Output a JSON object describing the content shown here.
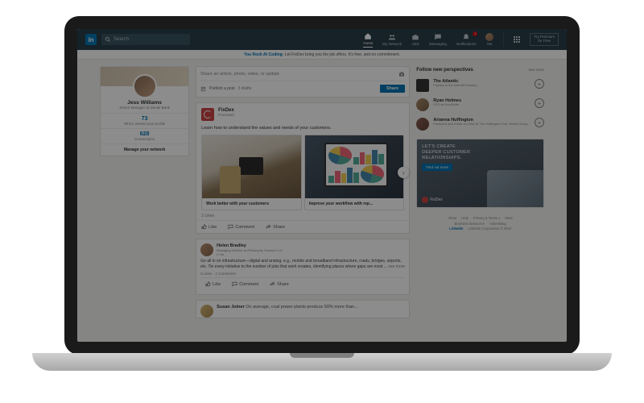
{
  "topbar": {
    "logo_text": "in",
    "search_placeholder": "Search",
    "nav": {
      "home": "Home",
      "network": "My Network",
      "jobs": "Jobs",
      "messaging": "Messaging",
      "notifications": "Notifications",
      "me": "Me",
      "notif_badge": "1"
    },
    "premium_line1": "Try Premium",
    "premium_line2": "for Free"
  },
  "banner": {
    "bold": "You Rock At Coding",
    "rest": " - Let FixDex bring you the job offers. It's free, and no commitment."
  },
  "profile": {
    "name": "Jess Williams",
    "title": "Senior Manager at Denali Bank",
    "views_count": "73",
    "views_label": "Who's viewed your profile",
    "conn_count": "628",
    "conn_label": "Connections",
    "manage": "Manage your network"
  },
  "sharebox": {
    "placeholder": "Share an article, photo, video, or update",
    "publish": "Publish a post",
    "drafts": "3 drafts",
    "share_btn": "Share"
  },
  "sponsored": {
    "company": "FixDex",
    "promo": "Promoted",
    "headline": "Learn how to understand the values and needs of your customers.",
    "slides": [
      {
        "caption": "Work better with your customers"
      },
      {
        "caption": "Improve your workflow with rep..."
      }
    ],
    "likes": "2 Likes",
    "actions": {
      "like": "Like",
      "comment": "Comment",
      "share": "Share"
    }
  },
  "post1": {
    "name": "Helen Bradley",
    "title": "Managing Director at Philosophy Science LLC",
    "time": "2 hrs",
    "body": "Go all in on infrastructure—digital and analog, e.g., mobile and broadband infrastructure, roads, bridges, airports, etc. Tie every initiative to the number of jobs that work creates, identifying places where gaps are most ... ",
    "see_more": "see more",
    "stats": "6 Likes · 1 Comments",
    "actions": {
      "like": "Like",
      "comment": "Comment",
      "share": "Share"
    }
  },
  "post2": {
    "name": "Susan Joiner",
    "snippet": "On average, coal power plants produce 50% more than..."
  },
  "follow": {
    "heading": "Follow new perspectives",
    "see_more": "See more",
    "items": [
      {
        "name": "The Atlantic",
        "sub": "Popular in the internet industry"
      },
      {
        "name": "Ryan Holmes",
        "sub": "CEO at HootSuite"
      },
      {
        "name": "Arianna Huffington",
        "sub": "President and Editor-in-Chief at The Huffington Post. Media Group"
      }
    ]
  },
  "ad": {
    "line1": "LET'S CREATE",
    "line2": "DEEPER CUSTOMER",
    "line3": "RELATIONSHIPS.",
    "cta": "Find out more",
    "brand": "FixDex"
  },
  "footer": {
    "row1": [
      "About",
      "Help",
      "Privacy & Terms ▾",
      "More"
    ],
    "row2": [
      "Business Services ▾",
      "Advertising"
    ],
    "copyright_brand": "LinkedIn",
    "copyright": "LinkedIn Corporation © 2016"
  }
}
